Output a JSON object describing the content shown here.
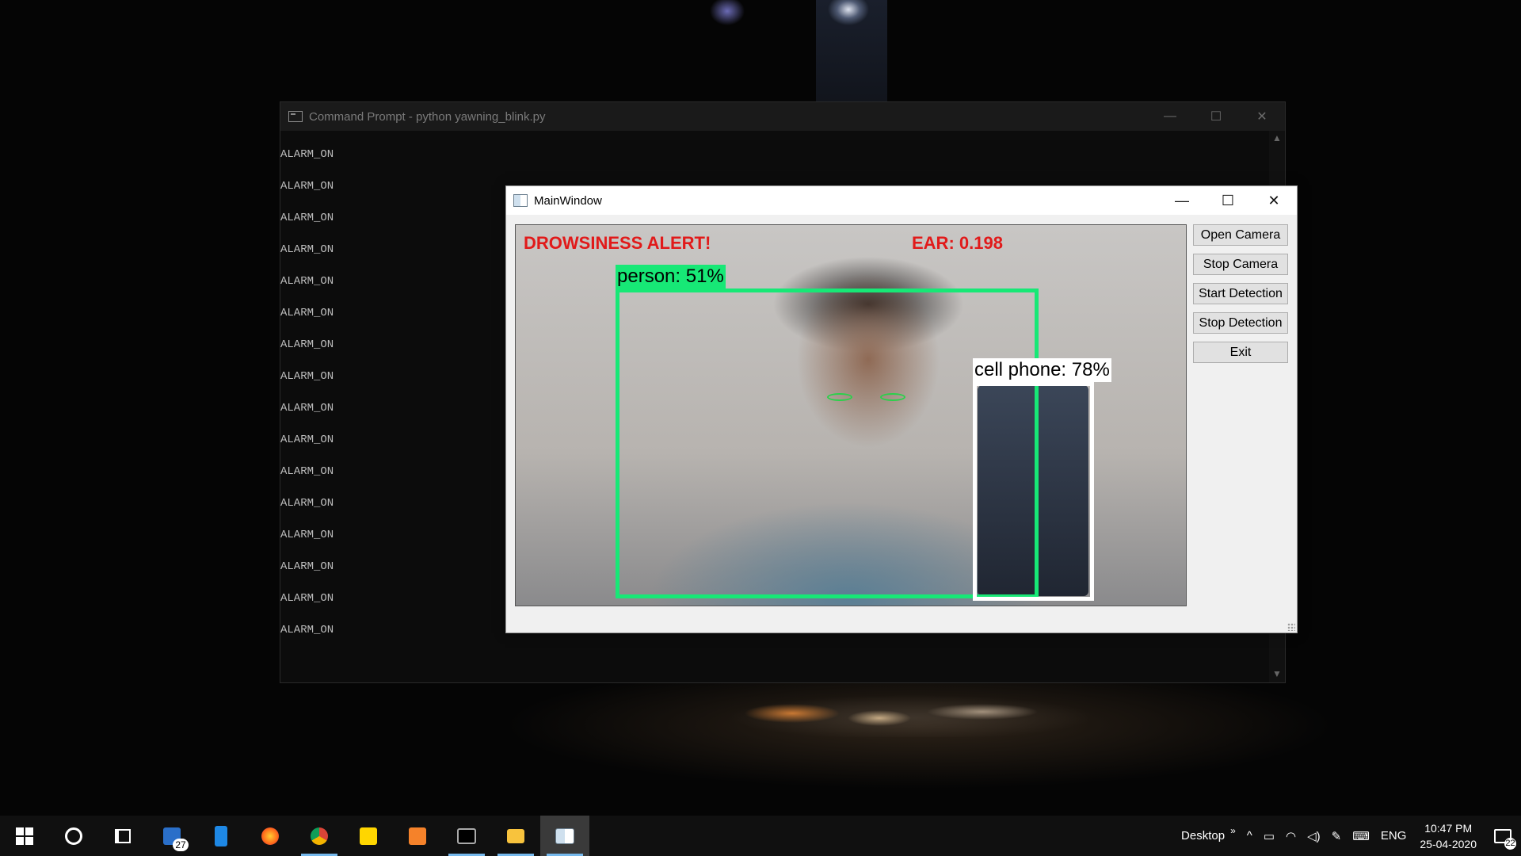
{
  "cmd": {
    "title": "Command Prompt - python  yawning_blink.py",
    "controls": {
      "minimize": "—",
      "maximize": "☐",
      "close": "✕"
    },
    "lines": [
      "ALARM_ON",
      "ALARM_ON",
      "ALARM_ON",
      "ALARM_ON",
      "ALARM_ON",
      "ALARM_ON",
      "ALARM_ON",
      "ALARM_ON",
      "ALARM_ON",
      "ALARM_ON",
      "ALARM_ON",
      "ALARM_ON",
      "ALARM_ON",
      "ALARM_ON",
      "ALARM_ON",
      "ALARM_ON"
    ],
    "scroll_up": "▲",
    "scroll_down": "▼"
  },
  "main_window": {
    "title": "MainWindow",
    "controls": {
      "minimize": "—",
      "maximize": "☐",
      "close": "✕"
    },
    "video": {
      "alert_text": "DROWSINESS ALERT!",
      "ear_text": "EAR: 0.198",
      "person_label": "person: 51%",
      "phone_label": "cell phone: 78%"
    },
    "buttons": {
      "open_camera": "Open Camera",
      "stop_camera": "Stop Camera",
      "start_detection": "Start Detection",
      "stop_detection": "Stop Detection",
      "exit": "Exit"
    }
  },
  "taskbar": {
    "mail_badge": "27",
    "desktop_label": "Desktop",
    "chevron": "»",
    "tray_up": "^",
    "language": "ENG",
    "time": "10:47 PM",
    "date": "25-04-2020",
    "notification_count": "22"
  },
  "colors": {
    "detection_box": "#17e876",
    "alert_text": "#e11a1a",
    "taskbar": "#101010"
  }
}
